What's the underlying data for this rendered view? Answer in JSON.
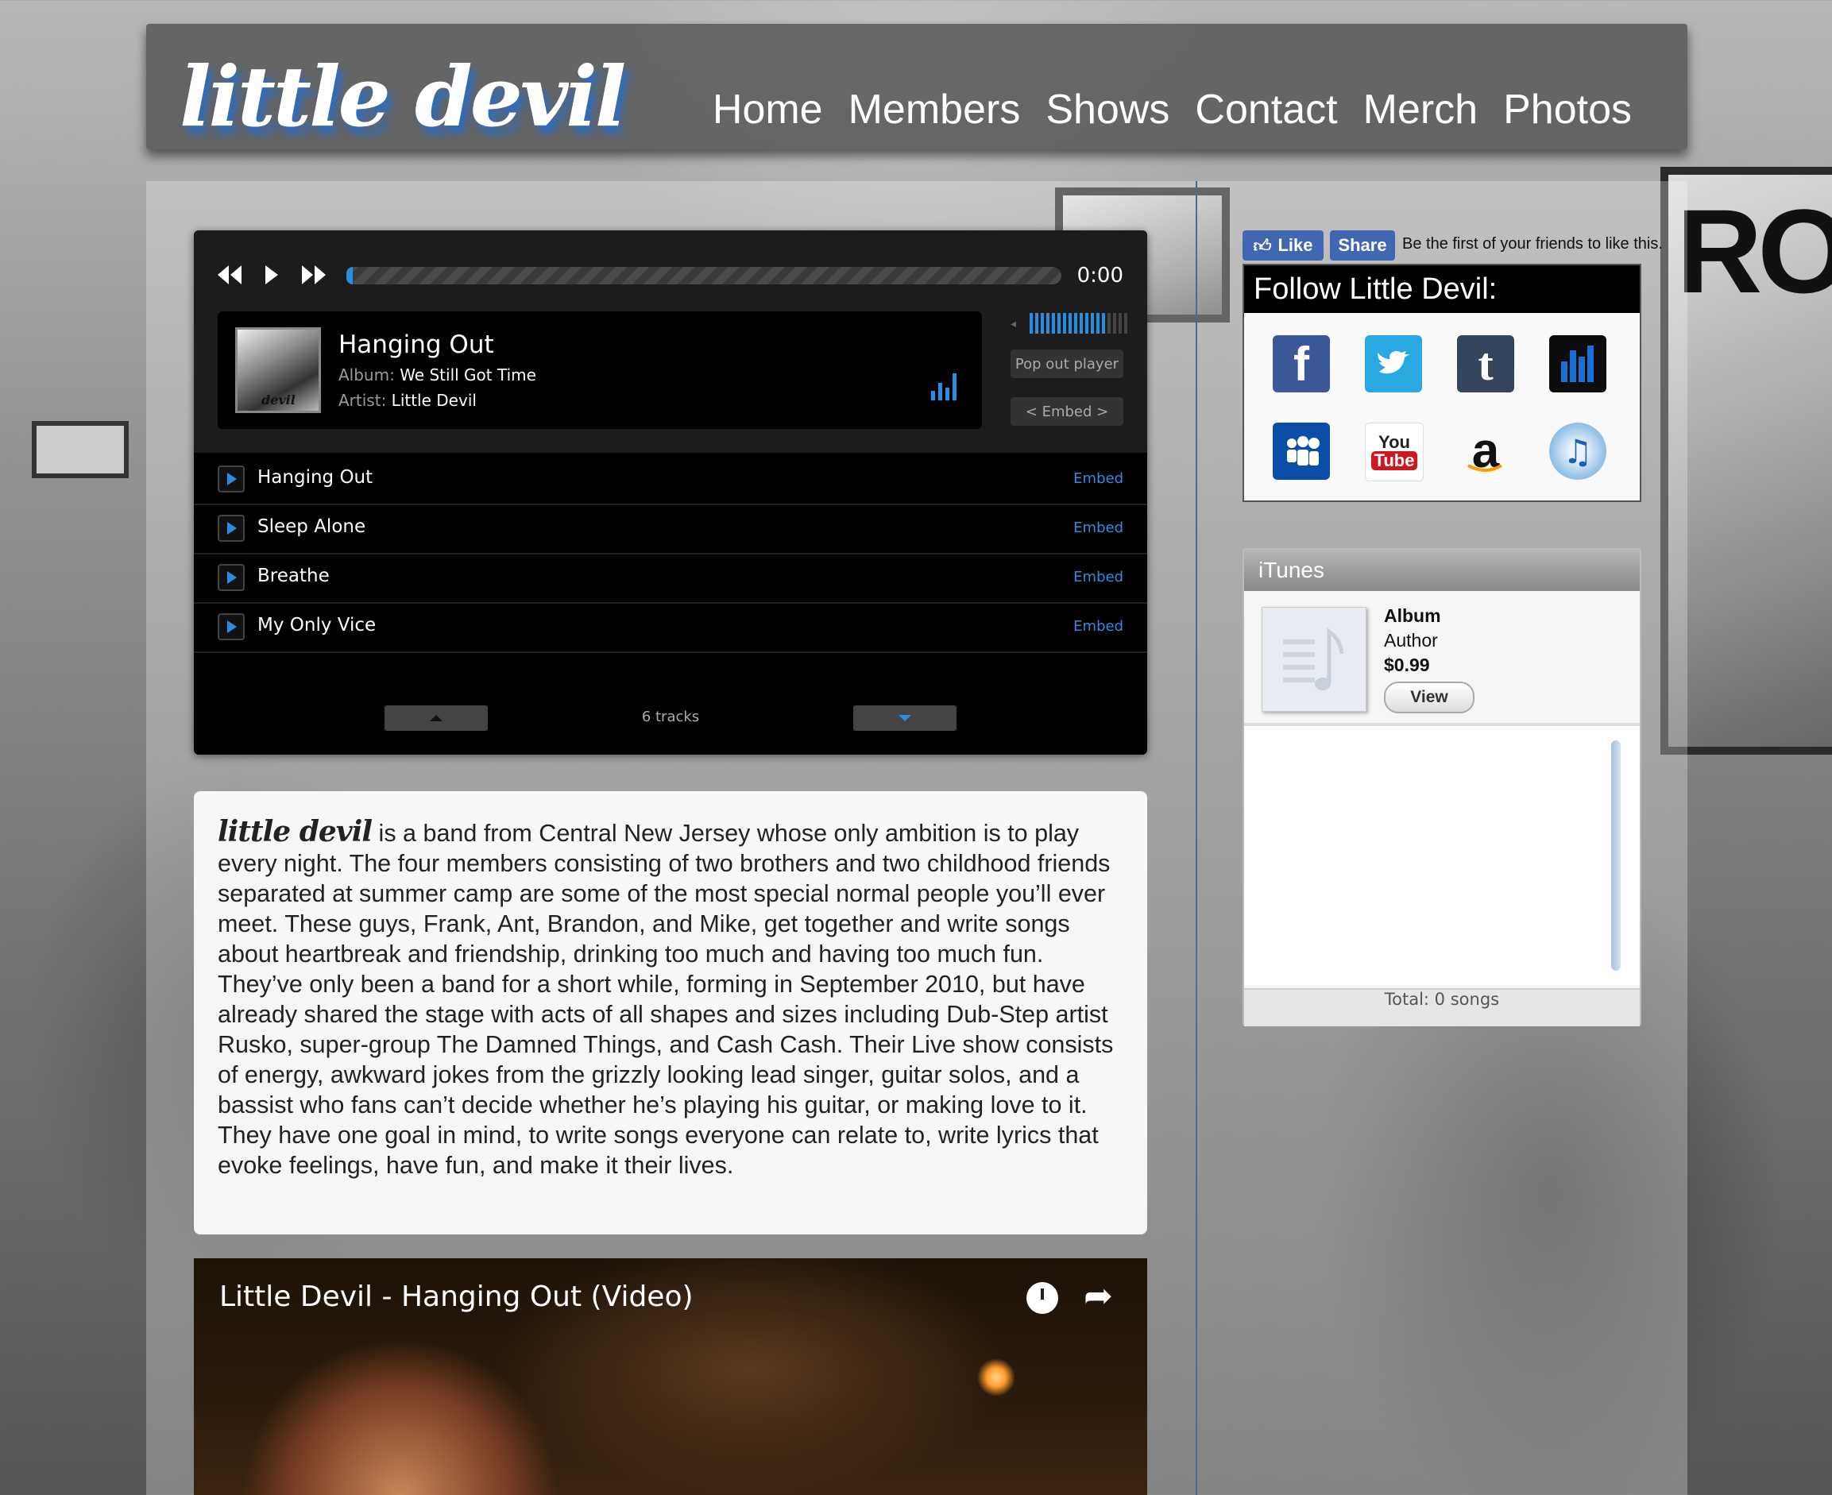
{
  "header": {
    "logo": "little devil",
    "nav": [
      "Home",
      "Members",
      "Shows",
      "Contact",
      "Merch",
      "Photos"
    ]
  },
  "player": {
    "time": "0:00",
    "progress": 0,
    "volume": 0.8,
    "now_playing": {
      "title": "Hanging Out",
      "album_label": "Album:",
      "album": "We Still Got Time",
      "artist_label": "Artist:",
      "artist": "Little Devil",
      "cover_text": "devil"
    },
    "pop_out_label": "Pop out player",
    "embed_label": "< Embed >",
    "tracks": [
      {
        "title": "Hanging Out",
        "embed": "Embed"
      },
      {
        "title": "Sleep Alone",
        "embed": "Embed"
      },
      {
        "title": "Breathe",
        "embed": "Embed"
      },
      {
        "title": "My Only Vice",
        "embed": "Embed"
      }
    ],
    "track_count": "6 tracks"
  },
  "bio": {
    "brand": "little devil",
    "text": " is a band from Central New Jersey whose only ambition is to play every night. The four members consisting of two brothers and two childhood friends separated at summer camp are some of the most special normal people you’ll ever meet. These guys, Frank, Ant, Brandon, and Mike, get together and write songs about heartbreak and friendship, drinking too much and having too much fun. They’ve only been a band for a short while, forming in September 2010, but have already shared the stage with acts of all shapes and sizes including Dub-Step artist Rusko, super-group The Damned Things, and Cash Cash. Their Live show consists of energy, awkward jokes from the grizzly looking lead singer, guitar solos, and a bassist who fans can’t decide whether he’s playing his guitar, or making love to it. They have one goal in mind, to write songs everyone can relate to, write lyrics that evoke feelings, have fun, and make it their lives."
  },
  "video": {
    "title": "Little Devil - Hanging Out (Video)"
  },
  "facebook": {
    "like_label": "Like",
    "share_label": "Share",
    "text": "Be the first of your friends to like this."
  },
  "follow": {
    "heading": "Follow Little Devil:",
    "icons": [
      "facebook-icon",
      "twitter-icon",
      "tumblr-icon",
      "reverbnation-icon",
      "myspace-icon",
      "youtube-icon",
      "amazon-icon",
      "itunes-icon"
    ],
    "youtube_text": [
      "You",
      "Tube"
    ]
  },
  "itunes": {
    "heading": "iTunes",
    "album": "Album",
    "author": "Author",
    "price": "$0.99",
    "view_label": "View",
    "total": "Total: 0 songs"
  },
  "colors": {
    "accent": "#2a8de0",
    "facebook": "#4267b2",
    "twitter": "#29a9e1",
    "tumblr": "#35465c",
    "reverbnation": "#1a6fd6",
    "myspace": "#0a4ea8",
    "youtube": "#cc181e"
  }
}
